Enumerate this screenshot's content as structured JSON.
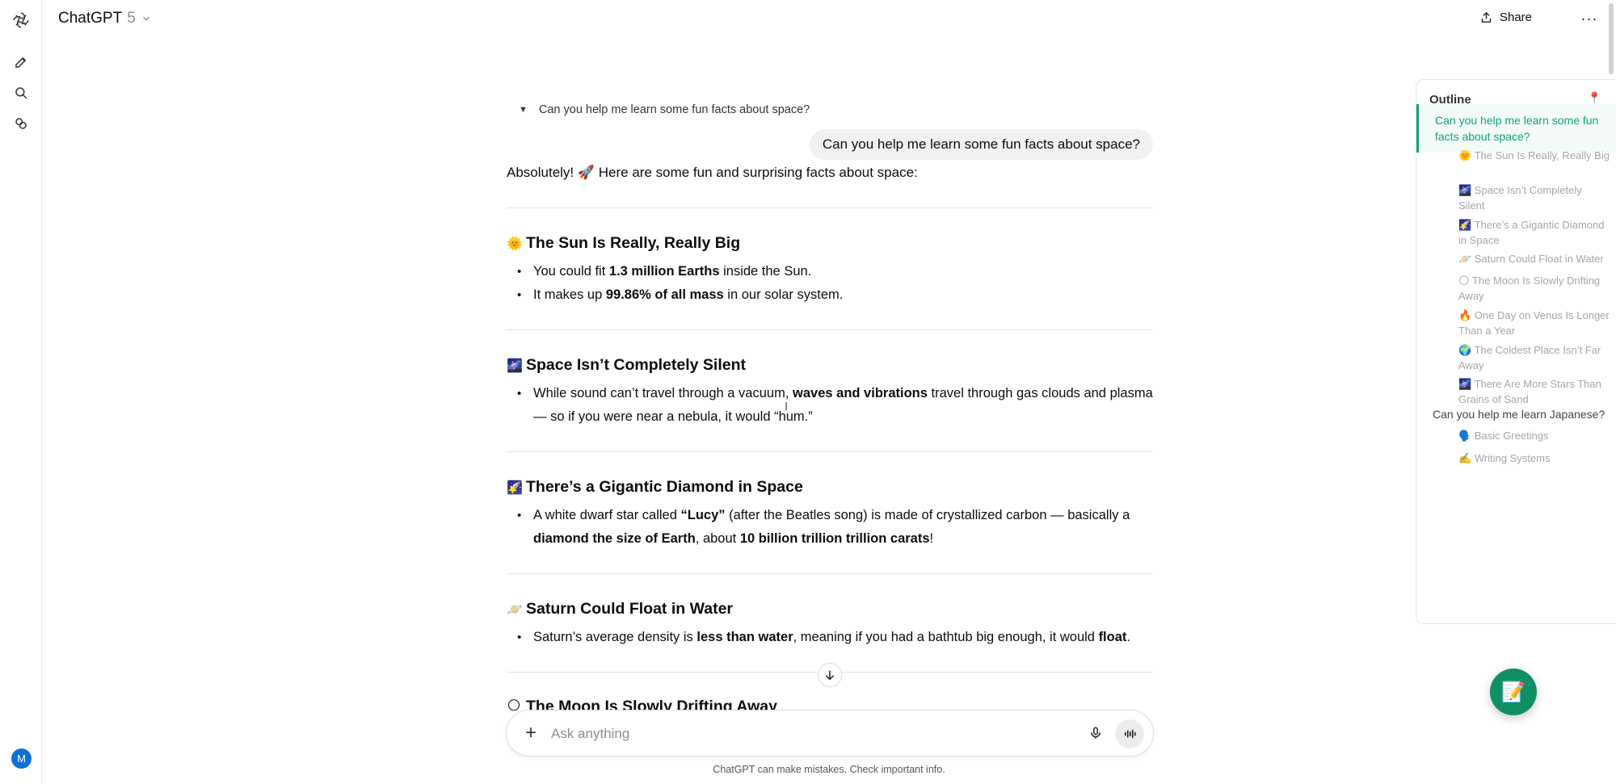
{
  "app": {
    "model_name": "ChatGPT",
    "model_version": "5",
    "share_label": "Share",
    "avatar_initial": "M",
    "more_glyph": "···"
  },
  "icons": {
    "logo": "openai-logo-icon",
    "new_chat": "edit-icon",
    "search": "search-icon",
    "library": "library-icon",
    "share": "upload-icon",
    "more": "more-horizontal-icon",
    "plus": "plus-icon",
    "mic": "microphone-icon",
    "voice": "voice-waveform-icon",
    "scroll_down": "arrow-down-icon",
    "pin": "pin-icon",
    "fab": "notepad-icon"
  },
  "conversation": {
    "toggle_label": "Can you help me learn some fun facts about space?",
    "user_message": "Can you help me learn some fun facts about space?",
    "intro": "Absolutely! 🚀 Here are some fun and surprising facts about space:",
    "sections": [
      {
        "emoji": "🌞",
        "title": "The Sun Is Really, Really Big",
        "bullets": [
          [
            {
              "t": "You could fit "
            },
            {
              "t": "1.3 million Earths",
              "b": true
            },
            {
              "t": " inside the Sun."
            }
          ],
          [
            {
              "t": "It makes up "
            },
            {
              "t": "99.86% of all mass",
              "b": true
            },
            {
              "t": " in our solar system."
            }
          ]
        ]
      },
      {
        "emoji": "🌌",
        "title": "Space Isn’t Completely Silent",
        "bullets": [
          [
            {
              "t": "While sound can’t travel through a vacuum, "
            },
            {
              "t": "waves and vibrations",
              "b": true
            },
            {
              "t": " travel through gas clouds and plasma — so if you were near a nebula, it would “hum.”"
            }
          ]
        ]
      },
      {
        "emoji": "🌠",
        "title": "There’s a Gigantic Diamond in Space",
        "bullets": [
          [
            {
              "t": "A white dwarf star called "
            },
            {
              "t": "“Lucy”",
              "b": true
            },
            {
              "t": " (after the Beatles song) is made of crystallized carbon — basically a "
            },
            {
              "t": "diamond the size of Earth",
              "b": true
            },
            {
              "t": ", about "
            },
            {
              "t": "10 billion trillion trillion carats",
              "b": true
            },
            {
              "t": "!"
            }
          ]
        ]
      },
      {
        "emoji": "🪐",
        "title": "Saturn Could Float in Water",
        "bullets": [
          [
            {
              "t": "Saturn’s average density is "
            },
            {
              "t": "less than water",
              "b": true
            },
            {
              "t": ", meaning if you had a bathtub big enough, it would "
            },
            {
              "t": "float",
              "b": true
            },
            {
              "t": "."
            }
          ]
        ]
      }
    ],
    "next_section": {
      "emoji": "🌕",
      "title": "The Moon Is Slowly Drifting Away"
    }
  },
  "composer": {
    "placeholder": "Ask anything",
    "disclaimer": "ChatGPT can make mistakes. Check important info."
  },
  "outline": {
    "title": "Outline",
    "items": [
      {
        "label": "Can you help me learn some fun facts about space?",
        "level": "top",
        "active": true
      },
      {
        "label": "🌞 The Sun Is Really, Really Big",
        "level": "sub"
      },
      {
        "label": "🌌 Space Isn’t Completely Silent",
        "level": "sub"
      },
      {
        "label": "🌠 There’s a Gigantic Diamond in Space",
        "level": "sub"
      },
      {
        "label": "🪐 Saturn Could Float in Water",
        "level": "sub"
      },
      {
        "label": "🌕 The Moon Is Slowly Drifting Away",
        "level": "sub"
      },
      {
        "label": "🔥 One Day on Venus Is Longer Than a Year",
        "level": "sub"
      },
      {
        "label": "🌍 The Coldest Place Isn’t Far Away",
        "level": "sub"
      },
      {
        "label": "🌌 There Are More Stars Than Grains of Sand",
        "level": "sub"
      },
      {
        "label": "Can you help me learn Japanese?",
        "level": "top"
      },
      {
        "label": "🗣️ Basic Greetings",
        "level": "sub"
      },
      {
        "label": "✍️ Writing Systems",
        "level": "sub"
      }
    ]
  }
}
